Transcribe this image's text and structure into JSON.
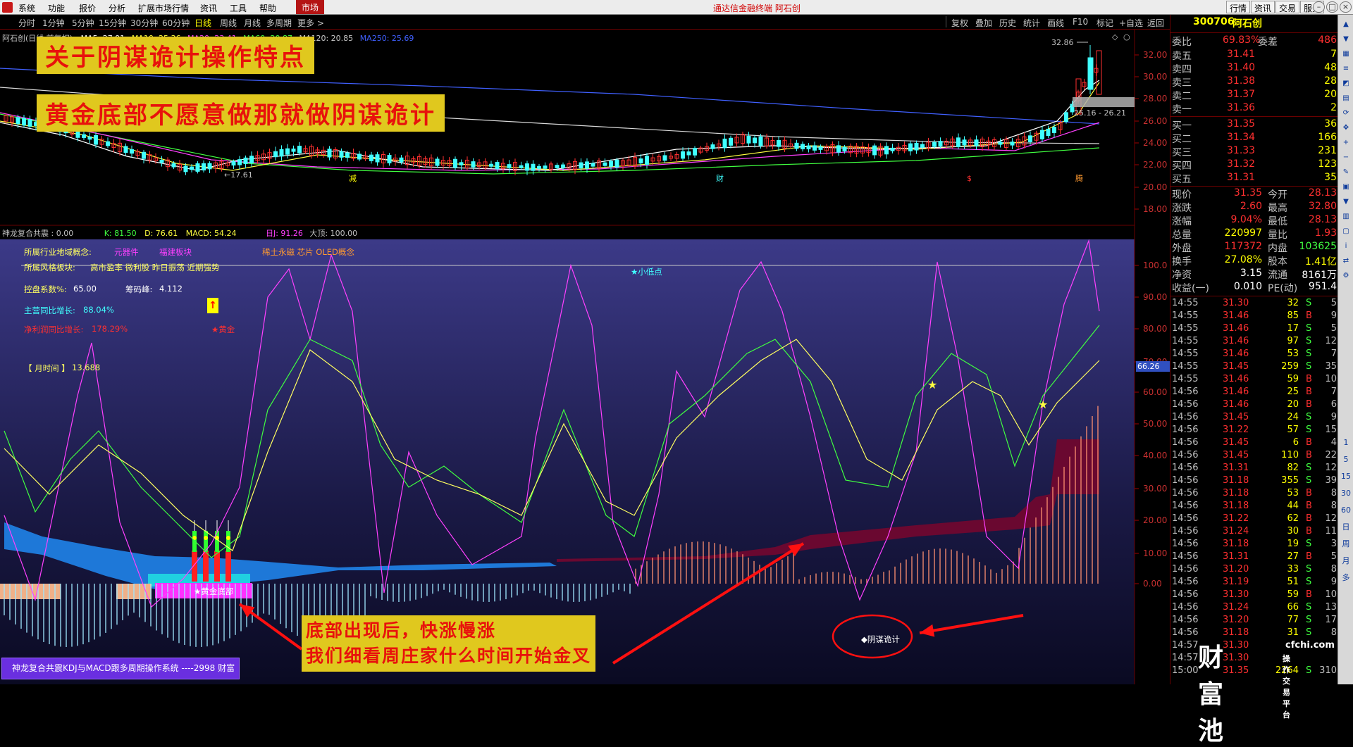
{
  "menubar": {
    "items": [
      "系统",
      "功能",
      "报价",
      "分析",
      "扩展市场行情",
      "资讯",
      "工具",
      "帮助"
    ],
    "market_tab": "市场",
    "center_title": "通达信金融终端  阿石创",
    "right_buttons": [
      "行情",
      "资讯",
      "交易",
      "服务"
    ]
  },
  "periods": {
    "items": [
      "分时",
      "1分钟",
      "5分钟",
      "15分钟",
      "30分钟",
      "60分钟",
      "日线",
      "周线",
      "月线",
      "多周期",
      "更多 >"
    ],
    "active": "日线",
    "tools": [
      "复权",
      "叠加",
      "历史",
      "统计",
      "画线",
      "F10",
      "标记",
      "+自选",
      "返回"
    ]
  },
  "main_chart": {
    "stock_label": "阿石创(日线,前复权)",
    "ma_legend": [
      {
        "text": "MA5: 27.91",
        "color": "#ffffff"
      },
      {
        "text": "MA10: 25.36",
        "color": "#ffff40"
      },
      {
        "text": "MA20: 23.41",
        "color": "#ff40ff"
      },
      {
        "text": "MA60: 20.87",
        "color": "#40ff40"
      },
      {
        "text": "MA120: 20.85",
        "color": "#c8c8c8"
      },
      {
        "text": "MA250: 25.69",
        "color": "#4060ff"
      }
    ],
    "price_axis": [
      "32.00",
      "30.00",
      "28.00",
      "26.00",
      "24.00",
      "22.00",
      "20.00",
      "18.00"
    ],
    "high_label": "32.86",
    "low_label": "17.61",
    "range_label": "25.16 - 26.21",
    "markers": [
      "减",
      "财",
      "$",
      "腾"
    ]
  },
  "banners": {
    "line1": "关于阴谋诡计操作特点",
    "line2": "黄金底部不愿意做那就做阴谋诡计"
  },
  "indicator": {
    "name": "神龙复合共震",
    "value": ": 0.00",
    "k": "K: 81.50",
    "d": "D: 76.61",
    "macd": "MACD: 54.24",
    "rj": "日J: 91.26",
    "dabo": "大顶: 100.00",
    "axis": [
      "100.0",
      "90.00",
      "80.00",
      "70.00",
      "60.00",
      "50.00",
      "40.00",
      "30.00",
      "20.00",
      "10.00",
      "0.00"
    ],
    "current_value": "66.26",
    "info": {
      "industry_label": "所属行业地域概念:",
      "industry_value": "元器件",
      "region_value": "福建板块",
      "concept_value": "稀土永磁 芯片 OLED概念",
      "style_label": "所属风格板块:",
      "style_value": "高市盈率 微利股 昨日振荡 近期强势",
      "control_label": "控盘系数%:",
      "control_value": "65.00",
      "chip_label": "筹码峰:",
      "chip_value": "4.112",
      "revenue_label": "主营同比增长:",
      "revenue_value": "88.04%",
      "profit_label": "净利润同比增长:",
      "profit_value": "178.29%",
      "month_label": "【 月时间 】",
      "month_value": "13.688",
      "gold_label": "★黄金",
      "low_point_label": "★小低点",
      "gold_bottom_label": "★黄金底部",
      "yinmou_label": "◆阴谋诡计",
      "footer": "神龙复合共震KDJ与MACD跟多周期操作系统 ----2998 财富"
    }
  },
  "callout": {
    "line1": "底部出现后，快涨慢涨",
    "line2": "我们细看周庄家什么时间开始金叉"
  },
  "quote": {
    "code": "300706",
    "name": "阿石创",
    "weibi_label": "委比",
    "weibi_value": "69.83%",
    "weicha_label": "委差",
    "weicha_value": "486",
    "asks": [
      {
        "label": "卖五",
        "price": "31.41",
        "vol": "7"
      },
      {
        "label": "卖四",
        "price": "31.40",
        "vol": "48"
      },
      {
        "label": "卖三",
        "price": "31.38",
        "vol": "28"
      },
      {
        "label": "卖二",
        "price": "31.37",
        "vol": "20"
      },
      {
        "label": "卖一",
        "price": "31.36",
        "vol": "2"
      }
    ],
    "bids": [
      {
        "label": "买一",
        "price": "31.35",
        "vol": "36"
      },
      {
        "label": "买二",
        "price": "31.34",
        "vol": "166"
      },
      {
        "label": "买三",
        "price": "31.33",
        "vol": "231"
      },
      {
        "label": "买四",
        "price": "31.32",
        "vol": "123"
      },
      {
        "label": "买五",
        "price": "31.31",
        "vol": "35"
      }
    ],
    "stats": [
      {
        "l1": "现价",
        "v1": "31.35",
        "l2": "今开",
        "v2": "28.13",
        "c1": "#ff3030",
        "c2": "#ff3030"
      },
      {
        "l1": "涨跌",
        "v1": "2.60",
        "l2": "最高",
        "v2": "32.80",
        "c1": "#ff3030",
        "c2": "#ff3030"
      },
      {
        "l1": "涨幅",
        "v1": "9.04%",
        "l2": "最低",
        "v2": "28.13",
        "c1": "#ff3030",
        "c2": "#ff3030"
      },
      {
        "l1": "总量",
        "v1": "220997",
        "l2": "量比",
        "v2": "1.93",
        "c1": "#ffff00",
        "c2": "#ff3030"
      },
      {
        "l1": "外盘",
        "v1": "117372",
        "l2": "内盘",
        "v2": "103625",
        "c1": "#ff3030",
        "c2": "#40ff40"
      },
      {
        "l1": "换手",
        "v1": "27.08%",
        "l2": "股本",
        "v2": "1.41亿",
        "c1": "#ffff00",
        "c2": "#ffff00"
      },
      {
        "l1": "净资",
        "v1": "3.15",
        "l2": "流通",
        "v2": "8161万",
        "c1": "#ffffff",
        "c2": "#ffffff"
      },
      {
        "l1": "收益(一)",
        "v1": "0.010",
        "l2": "PE(动)",
        "v2": "951.4",
        "c1": "#ffffff",
        "c2": "#ffffff"
      }
    ],
    "ticks": [
      {
        "t": "14:55",
        "p": "31.30",
        "v": "32",
        "s": "S",
        "n": "5"
      },
      {
        "t": "14:55",
        "p": "31.46",
        "v": "85",
        "s": "B",
        "n": "9"
      },
      {
        "t": "14:55",
        "p": "31.46",
        "v": "17",
        "s": "S",
        "n": "5"
      },
      {
        "t": "14:55",
        "p": "31.46",
        "v": "97",
        "s": "S",
        "n": "12"
      },
      {
        "t": "14:55",
        "p": "31.46",
        "v": "53",
        "s": "S",
        "n": "7"
      },
      {
        "t": "14:55",
        "p": "31.45",
        "v": "259",
        "s": "S",
        "n": "35"
      },
      {
        "t": "14:55",
        "p": "31.46",
        "v": "59",
        "s": "B",
        "n": "10"
      },
      {
        "t": "14:56",
        "p": "31.46",
        "v": "25",
        "s": "B",
        "n": "7"
      },
      {
        "t": "14:56",
        "p": "31.46",
        "v": "20",
        "s": "B",
        "n": "6"
      },
      {
        "t": "14:56",
        "p": "31.45",
        "v": "24",
        "s": "S",
        "n": "9"
      },
      {
        "t": "14:56",
        "p": "31.22",
        "v": "57",
        "s": "S",
        "n": "15"
      },
      {
        "t": "14:56",
        "p": "31.45",
        "v": "6",
        "s": "B",
        "n": "4"
      },
      {
        "t": "14:56",
        "p": "31.45",
        "v": "110",
        "s": "B",
        "n": "22"
      },
      {
        "t": "14:56",
        "p": "31.31",
        "v": "82",
        "s": "S",
        "n": "12"
      },
      {
        "t": "14:56",
        "p": "31.18",
        "v": "355",
        "s": "S",
        "n": "39"
      },
      {
        "t": "14:56",
        "p": "31.18",
        "v": "53",
        "s": "B",
        "n": "8"
      },
      {
        "t": "14:56",
        "p": "31.18",
        "v": "44",
        "s": "B",
        "n": "8"
      },
      {
        "t": "14:56",
        "p": "31.22",
        "v": "62",
        "s": "B",
        "n": "12"
      },
      {
        "t": "14:56",
        "p": "31.24",
        "v": "30",
        "s": "B",
        "n": "11"
      },
      {
        "t": "14:56",
        "p": "31.18",
        "v": "19",
        "s": "S",
        "n": "3"
      },
      {
        "t": "14:56",
        "p": "31.31",
        "v": "27",
        "s": "B",
        "n": "5"
      },
      {
        "t": "14:56",
        "p": "31.20",
        "v": "33",
        "s": "S",
        "n": "8"
      },
      {
        "t": "14:56",
        "p": "31.19",
        "v": "51",
        "s": "S",
        "n": "9"
      },
      {
        "t": "14:56",
        "p": "31.30",
        "v": "59",
        "s": "B",
        "n": "10"
      },
      {
        "t": "14:56",
        "p": "31.24",
        "v": "66",
        "s": "S",
        "n": "13"
      },
      {
        "t": "14:56",
        "p": "31.20",
        "v": "77",
        "s": "S",
        "n": "17"
      },
      {
        "t": "14:56",
        "p": "31.18",
        "v": "31",
        "s": "S",
        "n": "8"
      },
      {
        "t": "14:57",
        "p": "31.30",
        "v": "",
        "s": "",
        "n": ""
      },
      {
        "t": "14:57",
        "p": "31.30",
        "v": "",
        "s": "",
        "n": ""
      },
      {
        "t": "15:00",
        "p": "31.35",
        "v": "2264",
        "s": "S",
        "n": "310"
      }
    ]
  },
  "watermark": {
    "brand": "财富池",
    "site": "cfchi.com",
    "tag": "操作交易平台"
  },
  "toolstrip": [
    "1",
    "5",
    "15",
    "30",
    "60",
    "日",
    "周",
    "月",
    "多"
  ],
  "colors": {
    "up": "#ff3030",
    "down": "#40ffff",
    "accent": "#e0c81e",
    "panel_bg": "#2a2870"
  }
}
